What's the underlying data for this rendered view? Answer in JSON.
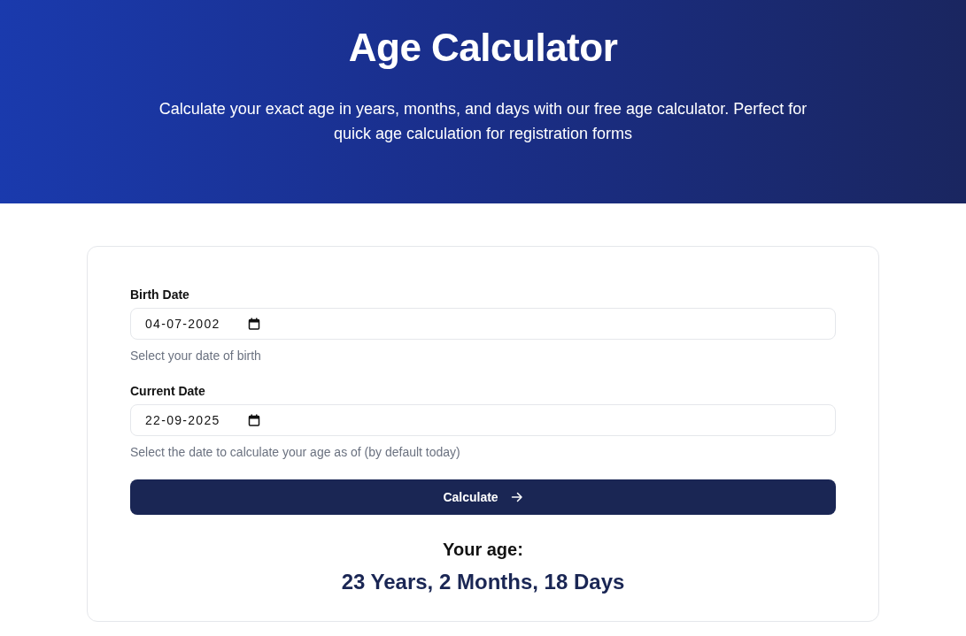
{
  "header": {
    "title": "Age Calculator",
    "subtitle": "Calculate your exact age in years, months, and days with our free age calculator. Perfect for quick age calculation for registration forms"
  },
  "form": {
    "fields": [
      {
        "label": "Birth Date",
        "value": "04-07-2002",
        "help": "Select your date of birth"
      },
      {
        "label": "Current Date",
        "value": "22-09-2025",
        "help": "Select the date to calculate your age as of (by default today)"
      }
    ],
    "button": {
      "label": "Calculate"
    }
  },
  "result": {
    "heading": "Your age:",
    "value": "23 Years, 2 Months, 18 Days"
  }
}
